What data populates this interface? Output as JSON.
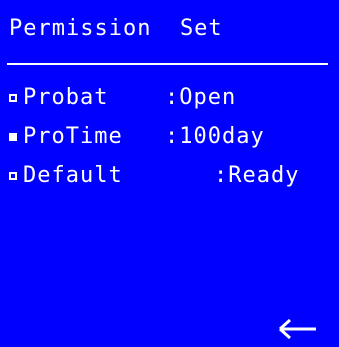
{
  "screen": {
    "title": "Permission  Set",
    "background_color": "#0000ff",
    "text_color": "#ffffff"
  },
  "settings": {
    "items": [
      {
        "label": "Probat",
        "value": ":Open",
        "marker": "hollow"
      },
      {
        "label": "ProTime",
        "value": ":100day",
        "marker": "filled",
        "selected": true
      },
      {
        "label": "Default",
        "value": ":Ready",
        "marker": "hollow"
      }
    ]
  },
  "footer": {
    "back_icon": "left-arrow-icon"
  }
}
